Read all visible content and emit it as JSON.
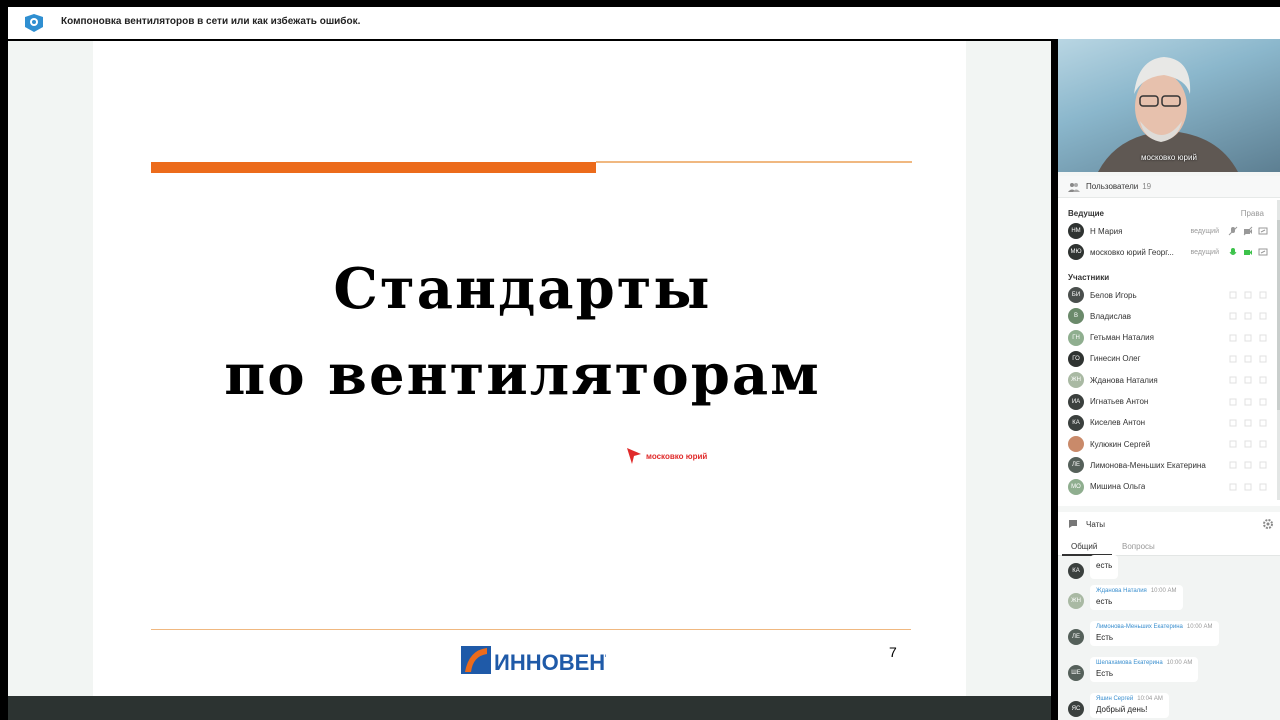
{
  "header": {
    "title": "Компоновка вентиляторов в сети или как избежать ошибок."
  },
  "slide": {
    "title_line1": "Стандарты",
    "title_line2": "по вентиляторам",
    "pointer_label": "московко юрий",
    "page_number": "7",
    "brand": "ИННОВЕНТ",
    "accent_color": "#ec6b1b"
  },
  "video": {
    "label": "московко юрий"
  },
  "users_panel": {
    "heading": "Пользователи",
    "count": "19",
    "hosts_label": "Ведущие",
    "rights_label": "Права",
    "participants_label": "Участники",
    "hosts": [
      {
        "initials": "НМ",
        "name": "Н Мария",
        "role": "ведущий"
      },
      {
        "initials": "МЮ",
        "name": "московко юрий Георг...",
        "role": "ведущий"
      }
    ],
    "participants": [
      {
        "initials": "БИ",
        "name": "Белов Игорь",
        "color": "#4a4f4d"
      },
      {
        "initials": "В",
        "name": "Владислав",
        "color": "#6b8a6b"
      },
      {
        "initials": "ГН",
        "name": "Гетьман Наталия",
        "color": "#8fae8f"
      },
      {
        "initials": "ГО",
        "name": "Гинесин Олег",
        "color": "#2f3331"
      },
      {
        "initials": "ЖН",
        "name": "Жданова Наталия",
        "color": "#a9b9a3"
      },
      {
        "initials": "ИА",
        "name": "Игнатьев Антон",
        "color": "#3b403e"
      },
      {
        "initials": "КА",
        "name": "Киселев Антон",
        "color": "#3b403e"
      },
      {
        "initials": "",
        "name": "Кулюкин Сергей",
        "color": "#c98a6a"
      },
      {
        "initials": "ЛЕ",
        "name": "Лимонова-Меньших Екатерина",
        "color": "#55605a"
      },
      {
        "initials": "МО",
        "name": "Мишина Ольга",
        "color": "#8fae8f"
      }
    ]
  },
  "chat": {
    "heading": "Чаты",
    "tabs": [
      "Общий",
      "Вопросы"
    ],
    "messages": [
      {
        "initials": "КА",
        "author": "",
        "time": "",
        "text": "есть",
        "color": "#3b403e"
      },
      {
        "initials": "ЖН",
        "author": "Жданова Наталия",
        "time": "10:00 AM",
        "text": "есть",
        "color": "#a9b9a3"
      },
      {
        "initials": "ЛЕ",
        "author": "Лимонова-Меньших Екатерина",
        "time": "10:00 AM",
        "text": "Есть",
        "color": "#55605a"
      },
      {
        "initials": "ШЕ",
        "author": "Шелахамова Екатерина",
        "time": "10:00 AM",
        "text": "Есть",
        "color": "#55605a"
      },
      {
        "initials": "ЯС",
        "author": "Яшин Сергей",
        "time": "10:04 AM",
        "text": "Добрый день!",
        "color": "#3b403e"
      }
    ]
  }
}
